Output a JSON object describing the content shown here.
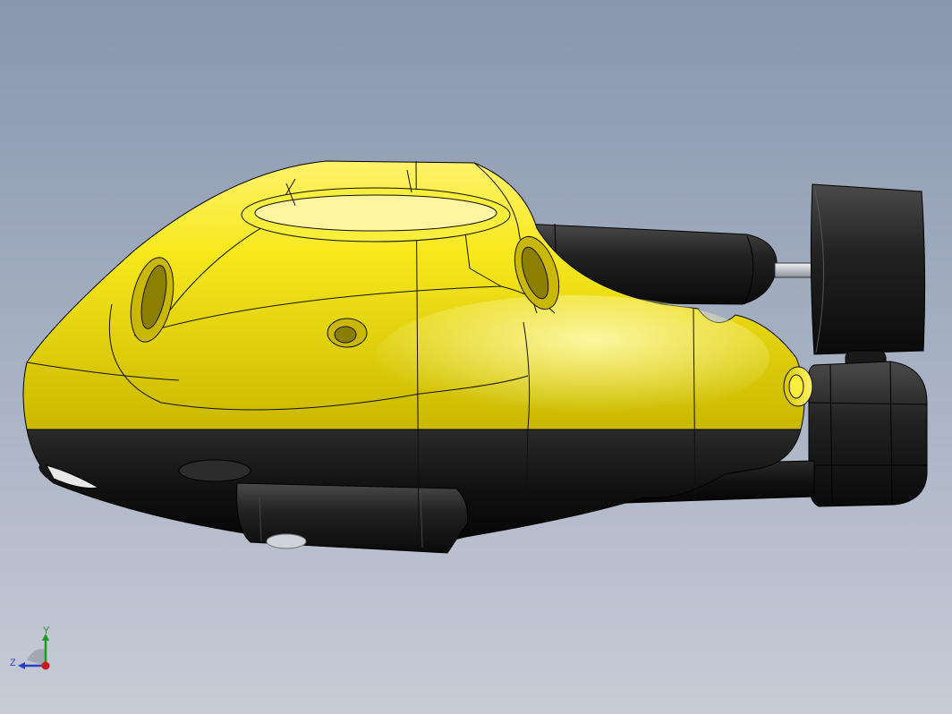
{
  "viewport": {
    "background_top": "#8996ad",
    "background_bottom": "#c7ccd6"
  },
  "model": {
    "description_icon": "rov-underwater-drone",
    "body_color": "#f2e51e",
    "dark_color": "#141414",
    "shaft_color": "#c8ccd2"
  },
  "triad": {
    "y_label": "Y",
    "z_label": "Z",
    "y_color": "#1e9a1e",
    "z_color": "#2a3fc0",
    "x_color": "#d01818"
  }
}
